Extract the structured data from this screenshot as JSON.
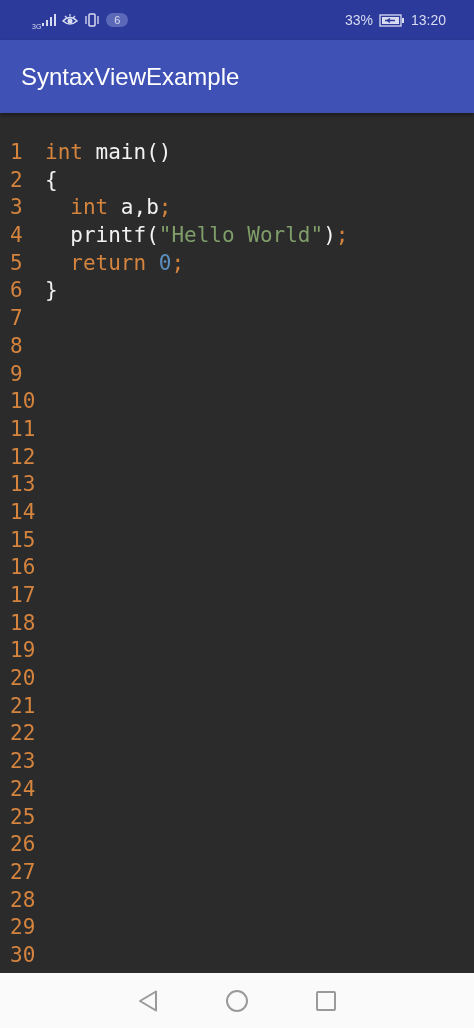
{
  "status_bar": {
    "network": "3G",
    "notification_count": "6",
    "battery_percent": "33%",
    "time": "13:20"
  },
  "app_bar": {
    "title": "SyntaxViewExample"
  },
  "editor": {
    "lines": [
      {
        "number": "1",
        "tokens": [
          {
            "kind": "keyword",
            "text": "int"
          },
          {
            "kind": "plain",
            "text": " main()"
          }
        ]
      },
      {
        "number": "2",
        "tokens": [
          {
            "kind": "plain",
            "text": "{"
          }
        ]
      },
      {
        "number": "3",
        "tokens": [
          {
            "kind": "keyword",
            "text": "  int"
          },
          {
            "kind": "plain",
            "text": " a,b"
          },
          {
            "kind": "punct",
            "text": ";"
          }
        ]
      },
      {
        "number": "4",
        "tokens": [
          {
            "kind": "plain",
            "text": "  printf("
          },
          {
            "kind": "string",
            "text": "\"Hello World\""
          },
          {
            "kind": "plain",
            "text": ")"
          },
          {
            "kind": "punct",
            "text": ";"
          }
        ]
      },
      {
        "number": "5",
        "tokens": [
          {
            "kind": "keyword",
            "text": "  return "
          },
          {
            "kind": "number",
            "text": "0"
          },
          {
            "kind": "punct",
            "text": ";"
          }
        ]
      },
      {
        "number": "6",
        "tokens": [
          {
            "kind": "plain",
            "text": "}"
          }
        ]
      },
      {
        "number": "7"
      },
      {
        "number": "8"
      },
      {
        "number": "9"
      },
      {
        "number": "10"
      },
      {
        "number": "11"
      },
      {
        "number": "12"
      },
      {
        "number": "13"
      },
      {
        "number": "14"
      },
      {
        "number": "15"
      },
      {
        "number": "16"
      },
      {
        "number": "17"
      },
      {
        "number": "18"
      },
      {
        "number": "19"
      },
      {
        "number": "20"
      },
      {
        "number": "21"
      },
      {
        "number": "22"
      },
      {
        "number": "23"
      },
      {
        "number": "24"
      },
      {
        "number": "25"
      },
      {
        "number": "26"
      },
      {
        "number": "27"
      },
      {
        "number": "28"
      },
      {
        "number": "29"
      },
      {
        "number": "30"
      }
    ]
  }
}
